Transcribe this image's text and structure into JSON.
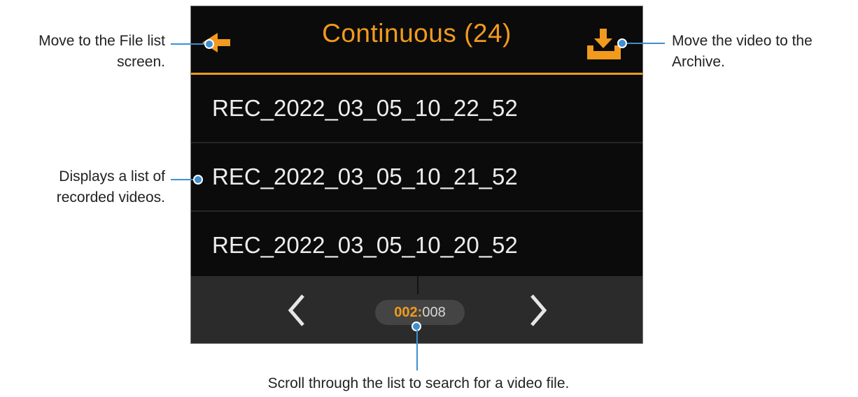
{
  "screen": {
    "title": "Continuous (24)",
    "accent_color": "#f29a1e",
    "back_icon": "arrow-left-icon",
    "archive_icon": "download-icon",
    "files": [
      "REC_2022_03_05_10_22_52",
      "REC_2022_03_05_10_21_52",
      "REC_2022_03_05_10_20_52"
    ],
    "pager": {
      "current": "002",
      "separator": ":",
      "total": "008"
    }
  },
  "callouts": {
    "back": [
      "Move to the File list",
      "screen."
    ],
    "archive": [
      "Move the video to the",
      "Archive."
    ],
    "list": [
      "Displays a list of",
      "recorded videos."
    ],
    "scroll": "Scroll through the list to search for a video file."
  }
}
